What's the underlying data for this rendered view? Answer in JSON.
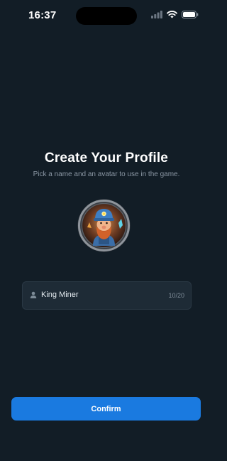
{
  "status_bar": {
    "time": "16:37"
  },
  "profile": {
    "title": "Create Your Profile",
    "subtitle": "Pick a name and an avatar to use in the game."
  },
  "name_field": {
    "value": "King Miner",
    "char_count": "10/20"
  },
  "confirm_label": "Confirm",
  "colors": {
    "background": "#121d26",
    "accent": "#1a7ae0",
    "field_bg": "#1e2b36",
    "muted_text": "#8a96a3"
  },
  "icons": [
    "signal-icon",
    "wifi-icon",
    "battery-icon",
    "person-icon",
    "miner-avatar"
  ]
}
